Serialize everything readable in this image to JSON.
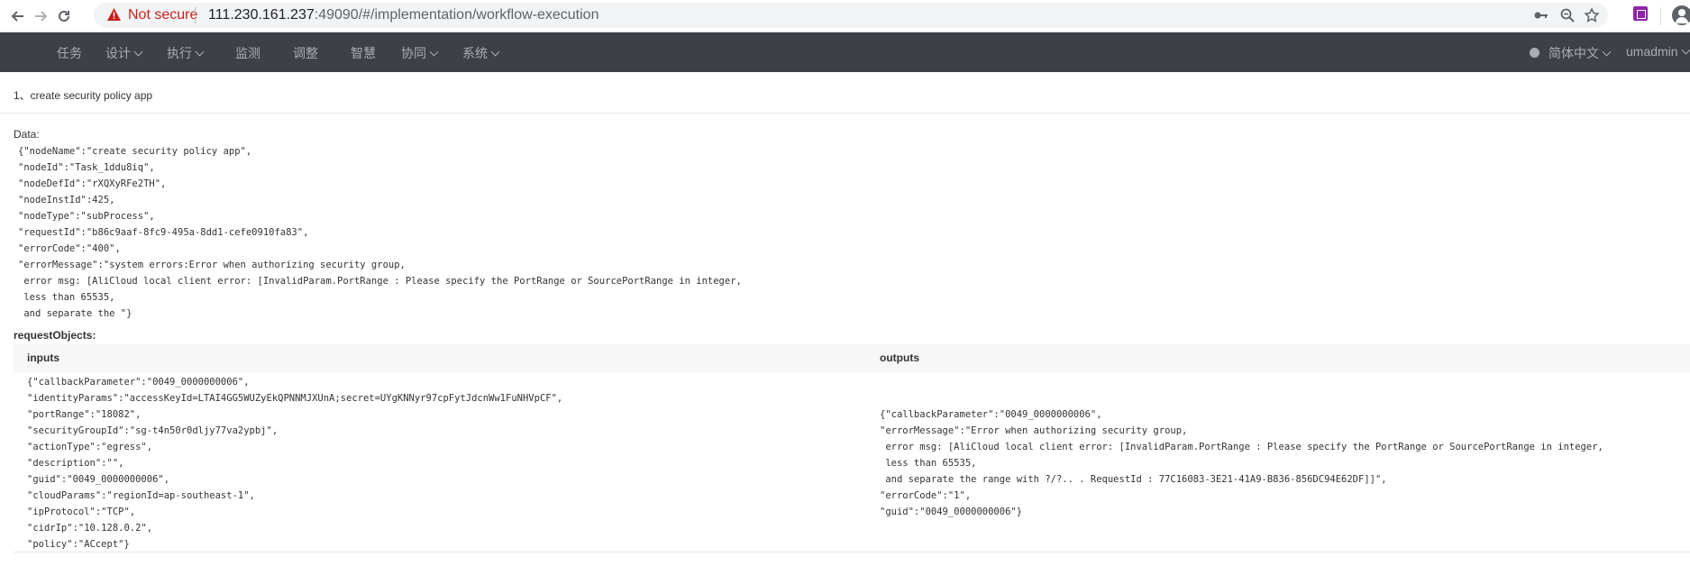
{
  "browser": {
    "security_label": "Not secure",
    "url_host": "111.230.161.237",
    "url_rest": ":49090/#/implementation/workflow-execution",
    "icons": [
      "back-icon",
      "forward-icon",
      "reload-icon",
      "warning-icon",
      "key-icon",
      "zoom-icon",
      "star-icon",
      "extension-icon",
      "profile-icon"
    ]
  },
  "nav": {
    "items": [
      {
        "label": "任务",
        "dropdown": false
      },
      {
        "label": "设计",
        "dropdown": true
      },
      {
        "label": "执行",
        "dropdown": true
      },
      {
        "label": "监测",
        "dropdown": false
      },
      {
        "label": "调整",
        "dropdown": false
      },
      {
        "label": "智慧",
        "dropdown": false
      },
      {
        "label": "协同",
        "dropdown": true
      },
      {
        "label": "系统",
        "dropdown": true
      }
    ],
    "language": "简体中文",
    "user": "umadmin"
  },
  "task": {
    "title": "1、create security policy app"
  },
  "detail": {
    "data_label": "Data:",
    "data_text": "{\"nodeName\":\"create security policy app\",\n\"nodeId\":\"Task_1ddu8iq\",\n\"nodeDefId\":\"rXQXyRFe2TH\",\n\"nodeInstId\":425,\n\"nodeType\":\"subProcess\",\n\"requestId\":\"b86c9aaf-8fc9-495a-8dd1-cefe0910fa83\",\n\"errorCode\":\"400\",\n\"errorMessage\":\"system errors:Error when authorizing security group,\n error msg: [AliCloud local client error: [InvalidParam.PortRange : Please specify the PortRange or SourcePortRange in integer,\n less than 65535,\n and separate the \"}",
    "request_objects_label": "requestObjects:",
    "inputs_header": "inputs",
    "outputs_header": "outputs",
    "inputs_text": "{\"callbackParameter\":\"0049_0000000006\",\n\"identityParams\":\"accessKeyId=LTAI4GG5WUZyEkQPNNMJXUnA;secret=UYgKNNyr97cpFytJdcnWw1FuNHVpCF\",\n\"portRange\":\"18082\",\n\"securityGroupId\":\"sg-t4n50r0dljy77va2ypbj\",\n\"actionType\":\"egress\",\n\"description\":\"\",\n\"guid\":\"0049_0000000006\",\n\"cloudParams\":\"regionId=ap-southeast-1\",\n\"ipProtocol\":\"TCP\",\n\"cidrIp\":\"10.128.0.2\",\n\"policy\":\"ACcept\"}",
    "outputs_text": "{\"callbackParameter\":\"0049_0000000006\",\n\"errorMessage\":\"Error when authorizing security group,\n error msg: [AliCloud local client error: [InvalidParam.PortRange : Please specify the PortRange or SourcePortRange in integer,\n less than 65535,\n and separate the range with ?/?.. . RequestId : 77C16083-3E21-41A9-B836-856DC94E62DF]]\",\n\"errorCode\":\"1\",\n\"guid\":\"0049_0000000006\"}"
  }
}
